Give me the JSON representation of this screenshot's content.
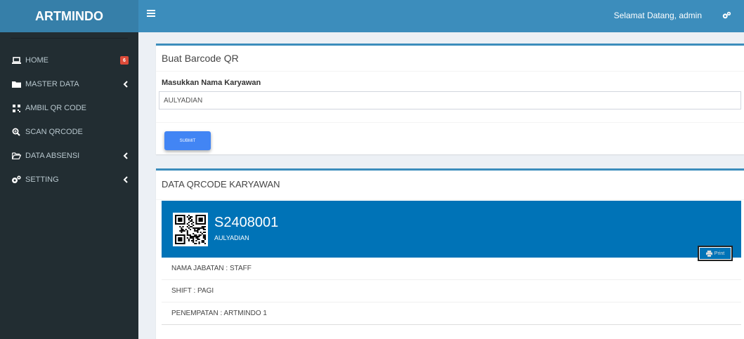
{
  "app": {
    "logo": "ARTMINDO"
  },
  "topbar": {
    "welcome": "Selamat Datang, admin"
  },
  "sidebar": {
    "items": [
      {
        "label": "HOME",
        "badge": "6"
      },
      {
        "label": "MASTER DATA"
      },
      {
        "label": "AMBIL QR CODE"
      },
      {
        "label": "SCAN QRCODE"
      },
      {
        "label": "DATA ABSENSI"
      },
      {
        "label": "SETTING"
      }
    ]
  },
  "form": {
    "title": "Buat Barcode QR",
    "label": "Masukkan Nama Karyawan",
    "input_value": "AULYADIAN",
    "submit_label": "SUBMIT"
  },
  "qrcard": {
    "title": "DATA QRCODE KARYAWAN",
    "employee_id": "S2408001",
    "employee_name": "AULYADIAN",
    "print_label": "Print",
    "rows": [
      "NAMA JABATAN : STAFF",
      "SHIFT : PAGI",
      "PENEMPATAN : ARTMINDO 1"
    ]
  },
  "colors": {
    "header": "#3c8dbc",
    "logo_bg": "#367fa9",
    "sidebar": "#222d32",
    "badge": "#dd4b39",
    "widget": "#0073b7",
    "submit": "#4285f4"
  },
  "icons": {
    "home": "laptop-icon",
    "master": "folder-icon",
    "ambil": "qrcode-icon",
    "scan": "search-plus-icon",
    "absensi": "folder-open-icon",
    "setting": "cogs-icon"
  }
}
